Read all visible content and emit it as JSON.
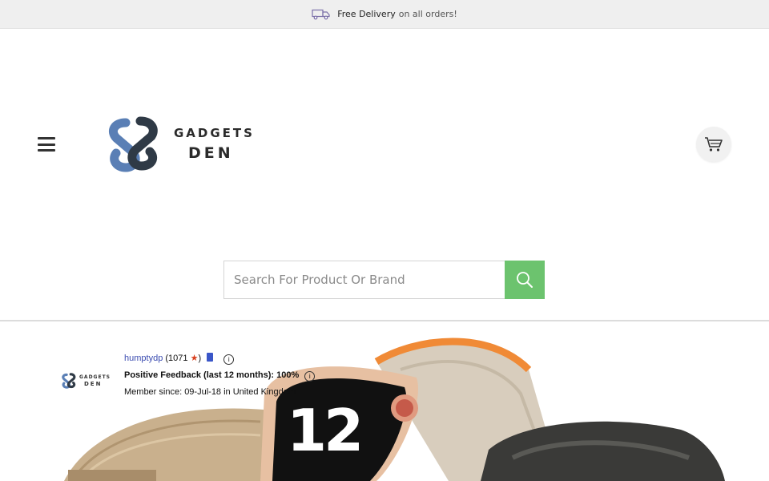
{
  "promo": {
    "icon": "truck-icon",
    "strong": "Free Delivery",
    "rest": "on all orders!"
  },
  "header": {
    "menu_icon": "hamburger-menu-icon",
    "logo_line1": "GADGETS",
    "logo_line2": "DEN",
    "cart_icon": "shopping-cart-icon"
  },
  "search": {
    "placeholder": "Search For Product Or Brand",
    "value": "",
    "button_icon": "search-icon"
  },
  "hero": {
    "seller_name": "humptydp",
    "seller_score": "1071",
    "feedback": "Positive Feedback (last 12 months): 100%",
    "member_since": "Member since: 09-Jul-18 in United Kingdom",
    "mini_logo_line1": "GADGETS",
    "mini_logo_line2": "DEN",
    "watch_face_text": "12"
  },
  "colors": {
    "search_button": "#6cc36e",
    "logo_blue": "#4a6fa5",
    "logo_dark": "#2f3a46",
    "topbar_bg": "#efefef"
  }
}
